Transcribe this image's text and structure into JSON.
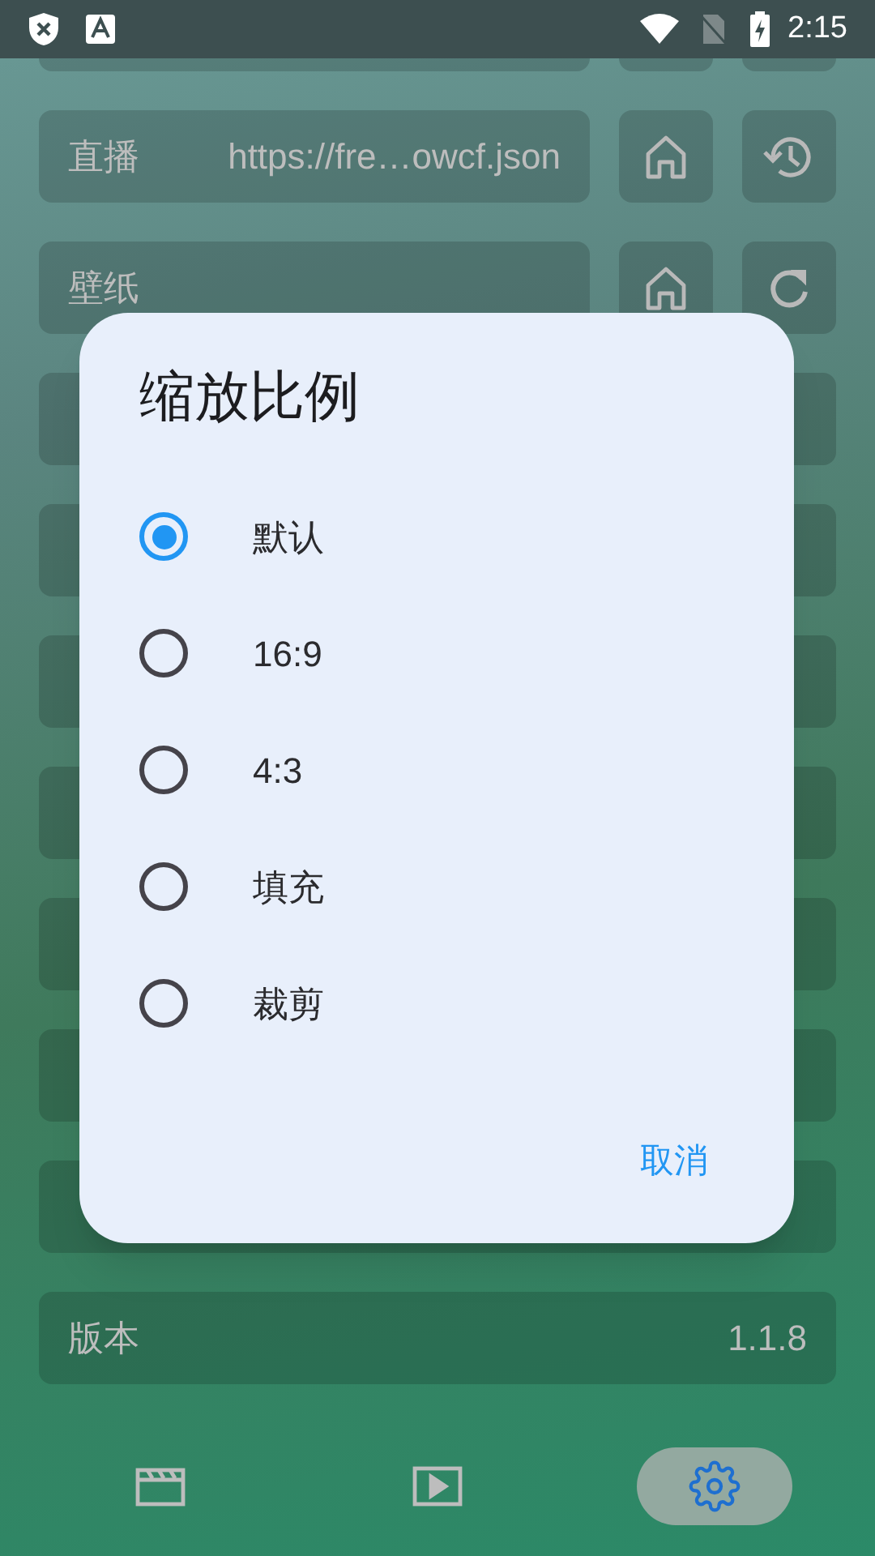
{
  "status_bar": {
    "time": "2:15"
  },
  "settings": [
    {
      "kind": "history",
      "label": "直播",
      "value": "https://fre…owcf.json"
    },
    {
      "kind": "refresh",
      "label": "壁纸"
    },
    {
      "kind": "plain"
    },
    {
      "kind": "plain"
    },
    {
      "kind": "plain"
    },
    {
      "kind": "plain"
    },
    {
      "kind": "plain"
    },
    {
      "kind": "plain"
    },
    {
      "kind": "plain"
    },
    {
      "kind": "plain",
      "label": "版本",
      "value": "1.1.8"
    }
  ],
  "nav": [
    {
      "selected": false
    },
    {
      "selected": false
    },
    {
      "selected": true
    }
  ],
  "dialog": {
    "title": "缩放比例",
    "options": [
      {
        "label": "默认",
        "selected": true
      },
      {
        "label": "16:9",
        "selected": false
      },
      {
        "label": "4:3",
        "selected": false
      },
      {
        "label": "填充",
        "selected": false
      },
      {
        "label": "裁剪",
        "selected": false
      }
    ],
    "cancel": "取消"
  }
}
